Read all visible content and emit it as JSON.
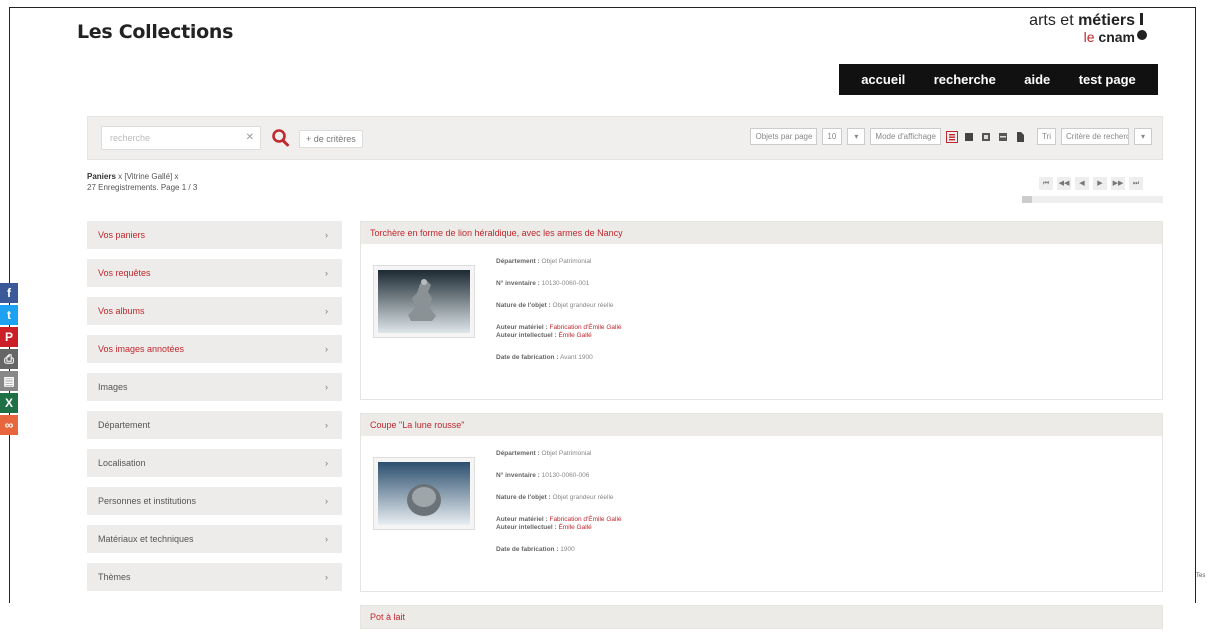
{
  "header": {
    "site_title": "Les Collections",
    "logo_line1a": "arts et ",
    "logo_line1b": "métiers",
    "logo_line2a": "le ",
    "logo_line2b": "cnam"
  },
  "nav": [
    {
      "name": "nav-accueil",
      "label": "accueil"
    },
    {
      "name": "nav-recherche",
      "label": "recherche"
    },
    {
      "name": "nav-aide",
      "label": "aide"
    },
    {
      "name": "nav-test-page",
      "label": "test page"
    }
  ],
  "search": {
    "placeholder": "recherche",
    "clear": "✕",
    "more_criteria": "+ de critères"
  },
  "toolbar": {
    "per_page_label": "Objets par page",
    "per_page_value": "10",
    "display_label": "Mode d'affichage",
    "sort_dir": "Tri",
    "sort_value": "Critère de recherche"
  },
  "filters": {
    "line1_a": "Paniers",
    "line1_b": "x   [Vitrine Gallé] x",
    "line2": "27 Enregistrements. Page 1 / 3"
  },
  "pager": [
    "⏮",
    "◀◀",
    "◀",
    "▶",
    "▶▶",
    "⏭"
  ],
  "pager_progress": 0.07,
  "social": [
    {
      "name": "facebook-icon",
      "glyph": "f",
      "color": "#3b5998"
    },
    {
      "name": "twitter-icon",
      "glyph": "t",
      "color": "#1da1f2"
    },
    {
      "name": "pinterest-icon",
      "glyph": "P",
      "color": "#cb2027"
    },
    {
      "name": "print-icon",
      "glyph": "⎙",
      "color": "#666666"
    },
    {
      "name": "pdf-icon",
      "glyph": "▤",
      "color": "#888888"
    },
    {
      "name": "export-icon",
      "glyph": "X",
      "color": "#1e7145"
    },
    {
      "name": "link-icon",
      "glyph": "∞",
      "color": "#e8663d"
    }
  ],
  "sidebar": [
    {
      "label": "Vos paniers",
      "red": true
    },
    {
      "label": "Vos requêtes",
      "red": true
    },
    {
      "label": "Vos albums",
      "red": true
    },
    {
      "label": "Vos images annotées",
      "red": true
    },
    {
      "label": "Images",
      "red": false
    },
    {
      "label": "Département",
      "red": false
    },
    {
      "label": "Localisation",
      "red": false
    },
    {
      "label": "Personnes et institutions",
      "red": false
    },
    {
      "label": "Matériaux et techniques",
      "red": false
    },
    {
      "label": "Thèmes",
      "red": false
    }
  ],
  "results": [
    {
      "title": "Torchère en forme de lion héraldique, avec les armes de Nancy",
      "dept_label": "Département :",
      "dept": "Objet Patrimonial",
      "inv_label": "N° inventaire :",
      "inv": "10130-0060-001",
      "nature_label": "Nature de l'objet :",
      "nature": "Objet grandeur réelle",
      "auteur_mat_label": "Auteur matériel :",
      "auteur_mat": "Fabrication d'Émile Gallé",
      "auteur_int_label": "Auteur intellectuel :",
      "auteur_int": "Émile Gallé",
      "date_label": "Date de fabrication :",
      "date": "Avant 1900"
    },
    {
      "title": "Coupe \"La lune rousse\"",
      "dept_label": "Département :",
      "dept": "Objet Patrimonial",
      "inv_label": "N° inventaire :",
      "inv": "10130-0060-006",
      "nature_label": "Nature de l'objet :",
      "nature": "Objet grandeur réelle",
      "auteur_mat_label": "Auteur matériel :",
      "auteur_mat": "Fabrication d'Émile Gallé",
      "auteur_int_label": "Auteur intellectuel :",
      "auteur_int": "Émile Gallé",
      "date_label": "Date de fabrication :",
      "date": "1900"
    },
    {
      "title": "Pot à lait"
    }
  ],
  "edge_label": "Tes"
}
